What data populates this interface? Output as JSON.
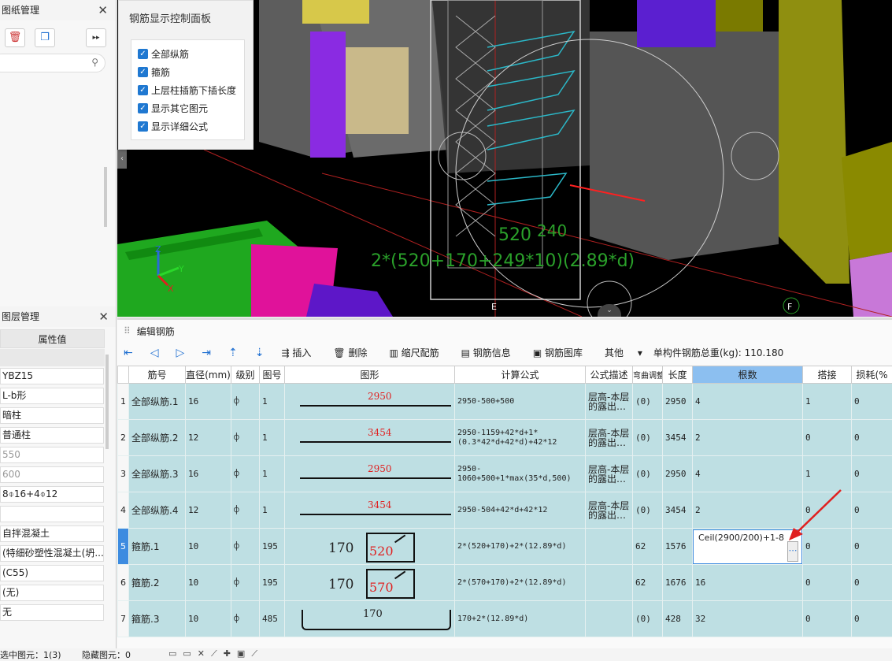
{
  "left": {
    "drawing_panel_title": "图纸管理",
    "layer_panel_title": "图层管理",
    "prop_header": "属性值",
    "props": [
      "YBZ15",
      "L-b形",
      "暗柱",
      "普通柱",
      "550",
      "600",
      "8⌽16+4⌽12",
      "",
      "自拌混凝土",
      "(特细砂塑性混凝土(坍...",
      "(C55)",
      "(无)",
      "无"
    ]
  },
  "control_panel": {
    "title": "钢筋显示控制面板",
    "options": [
      "全部纵筋",
      "箍筋",
      "上层柱插筋下插长度",
      "显示其它图元",
      "显示详细公式"
    ]
  },
  "viewport": {
    "dim_520": "520",
    "dim_240": "240",
    "formula_overlay": "2*(520+170+249*10)(2.89*d)",
    "axis_label_e": "E",
    "axis_label_f": "F",
    "axis_x": "X",
    "axis_y": "Y",
    "axis_z": "Z"
  },
  "editor": {
    "title": "编辑钢筋",
    "toolbar": {
      "insert": "插入",
      "delete": "删除",
      "scale": "缩尺配筋",
      "info": "钢筋信息",
      "library": "钢筋图库",
      "other": "其他",
      "weight_label": "单构件钢筋总重(kg): 110.180"
    },
    "columns": [
      "",
      "筋号",
      "直径(mm)",
      "级别",
      "图号",
      "图形",
      "计算公式",
      "公式描述",
      "弯曲调整",
      "长度",
      "根数",
      "搭接",
      "损耗(%"
    ],
    "rows": [
      {
        "n": "1",
        "name": "全部纵筋.1",
        "dia": "16",
        "grade": "⌽",
        "fig": "1",
        "shape": "2950",
        "formula": "2950-500+500",
        "desc": "层高-本层的露出…",
        "bend": "(0)",
        "len": "2950",
        "count": "4",
        "lap": "1",
        "loss": "0"
      },
      {
        "n": "2",
        "name": "全部纵筋.2",
        "dia": "12",
        "grade": "⌽",
        "fig": "1",
        "shape": "3454",
        "formula": "2950-1159+42*d+1*(0.3*42*d+42*d)+42*12",
        "desc": "层高-本层的露出…",
        "bend": "(0)",
        "len": "3454",
        "count": "2",
        "lap": "0",
        "loss": "0"
      },
      {
        "n": "3",
        "name": "全部纵筋.3",
        "dia": "16",
        "grade": "⌽",
        "fig": "1",
        "shape": "2950",
        "formula": "2950-1060+500+1*max(35*d,500)",
        "desc": "层高-本层的露出…",
        "bend": "(0)",
        "len": "2950",
        "count": "4",
        "lap": "1",
        "loss": "0"
      },
      {
        "n": "4",
        "name": "全部纵筋.4",
        "dia": "12",
        "grade": "⌽",
        "fig": "1",
        "shape": "3454",
        "formula": "2950-504+42*d+42*12",
        "desc": "层高-本层的露出…",
        "bend": "(0)",
        "len": "3454",
        "count": "2",
        "lap": "0",
        "loss": "0"
      },
      {
        "n": "5",
        "name": "箍筋.1",
        "dia": "10",
        "grade": "⌽",
        "fig": "195",
        "shape_a": "170",
        "shape_b": "520",
        "formula": "2*(520+170)+2*(12.89*d)",
        "desc": "",
        "bend": "62",
        "len": "1576",
        "count": "Ceil(2900/200)+1-8",
        "lap": "0",
        "loss": "0"
      },
      {
        "n": "6",
        "name": "箍筋.2",
        "dia": "10",
        "grade": "⌽",
        "fig": "195",
        "shape_a": "170",
        "shape_b": "570",
        "formula": "2*(570+170)+2*(12.89*d)",
        "desc": "",
        "bend": "62",
        "len": "1676",
        "count": "16",
        "lap": "0",
        "loss": "0"
      },
      {
        "n": "7",
        "name": "箍筋.3",
        "dia": "10",
        "grade": "⌽",
        "fig": "485",
        "shape": "170",
        "formula": "170+2*(12.89*d)",
        "desc": "",
        "bend": "(0)",
        "len": "428",
        "count": "32",
        "lap": "0",
        "loss": "0"
      }
    ]
  },
  "status": {
    "selected": "选中图元：1(3)",
    "hidden": "隐藏图元：0"
  },
  "colors": {
    "accent": "#1f78d1",
    "row_bg": "#bedfe3",
    "selected_header": "#8cbff0",
    "red": "#e02020"
  }
}
